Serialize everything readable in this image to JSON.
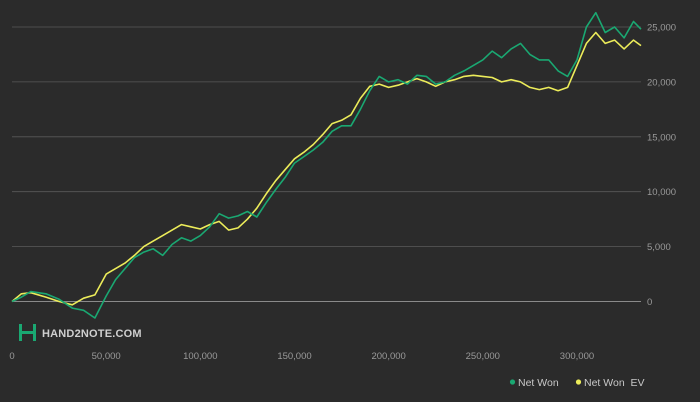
{
  "logo": {
    "text": "HAND2NOTE.COM"
  },
  "colors": {
    "background": "#2b2b2b",
    "grid": "#5a5a5a",
    "zero_line": "#8a8a8a",
    "net_won": "#1aa872",
    "net_won_ev": "#ecec5a"
  },
  "chart_data": {
    "type": "line",
    "title": "",
    "xlabel": "",
    "ylabel": "",
    "xlim": [
      0,
      334000
    ],
    "ylim": [
      -1500,
      27000
    ],
    "x_ticks": [
      0,
      50000,
      100000,
      150000,
      200000,
      250000,
      300000
    ],
    "x_tick_labels": [
      "0",
      "50,000",
      "100,000",
      "150,000",
      "200,000",
      "250,000",
      "300,000"
    ],
    "y_ticks": [
      0,
      5000,
      10000,
      15000,
      20000,
      25000
    ],
    "y_tick_labels": [
      "0",
      "5,000",
      "10,000",
      "15,000",
      "20,000",
      "25,000"
    ],
    "y_axis_side": "right",
    "grid": "horizontal",
    "legend_position": "bottom-right",
    "series": [
      {
        "name": "Net Won",
        "color": "#1aa872",
        "x": [
          0,
          5000,
          10000,
          18000,
          25000,
          32000,
          38000,
          44000,
          50000,
          55000,
          60000,
          65000,
          70000,
          75000,
          80000,
          85000,
          90000,
          95000,
          100000,
          105000,
          110000,
          115000,
          120000,
          125000,
          130000,
          135000,
          140000,
          145000,
          150000,
          155000,
          160000,
          165000,
          170000,
          175000,
          180000,
          185000,
          190000,
          195000,
          200000,
          205000,
          210000,
          215000,
          220000,
          225000,
          230000,
          235000,
          240000,
          245000,
          250000,
          255000,
          260000,
          265000,
          270000,
          275000,
          280000,
          285000,
          290000,
          295000,
          300000,
          305000,
          310000,
          315000,
          320000,
          325000,
          330000,
          334000
        ],
        "y": [
          0,
          400,
          900,
          700,
          200,
          -600,
          -800,
          -1500,
          500,
          2000,
          3000,
          4000,
          4500,
          4800,
          4200,
          5200,
          5800,
          5500,
          6000,
          6800,
          8000,
          7600,
          7800,
          8200,
          7700,
          9000,
          10200,
          11300,
          12600,
          13200,
          13800,
          14500,
          15500,
          16000,
          16000,
          17500,
          19200,
          20500,
          20000,
          20200,
          19800,
          20600,
          20500,
          19800,
          20000,
          20600,
          21000,
          21500,
          22000,
          22800,
          22200,
          23000,
          23500,
          22500,
          22000,
          22000,
          21000,
          20500,
          22000,
          25000,
          26300,
          24500,
          25000,
          24000,
          25500,
          24800
        ]
      },
      {
        "name": "Net Won  EV",
        "color": "#ecec5a",
        "x": [
          0,
          5000,
          10000,
          18000,
          25000,
          32000,
          38000,
          44000,
          50000,
          55000,
          60000,
          65000,
          70000,
          75000,
          80000,
          85000,
          90000,
          95000,
          100000,
          105000,
          110000,
          115000,
          120000,
          125000,
          130000,
          135000,
          140000,
          145000,
          150000,
          155000,
          160000,
          165000,
          170000,
          175000,
          180000,
          185000,
          190000,
          195000,
          200000,
          205000,
          210000,
          215000,
          220000,
          225000,
          230000,
          235000,
          240000,
          245000,
          250000,
          255000,
          260000,
          265000,
          270000,
          275000,
          280000,
          285000,
          290000,
          295000,
          300000,
          305000,
          310000,
          315000,
          320000,
          325000,
          330000,
          334000
        ],
        "y": [
          0,
          700,
          800,
          400,
          0,
          -300,
          300,
          600,
          2500,
          3000,
          3500,
          4200,
          5000,
          5500,
          6000,
          6500,
          7000,
          6800,
          6600,
          7000,
          7300,
          6500,
          6700,
          7500,
          8500,
          9800,
          11000,
          12000,
          13000,
          13600,
          14300,
          15200,
          16200,
          16500,
          17000,
          18500,
          19600,
          19800,
          19500,
          19700,
          20000,
          20300,
          20000,
          19600,
          20000,
          20200,
          20500,
          20600,
          20500,
          20400,
          20000,
          20200,
          20000,
          19500,
          19300,
          19500,
          19200,
          19500,
          21500,
          23500,
          24500,
          23500,
          23800,
          23000,
          23800,
          23300
        ]
      }
    ]
  }
}
